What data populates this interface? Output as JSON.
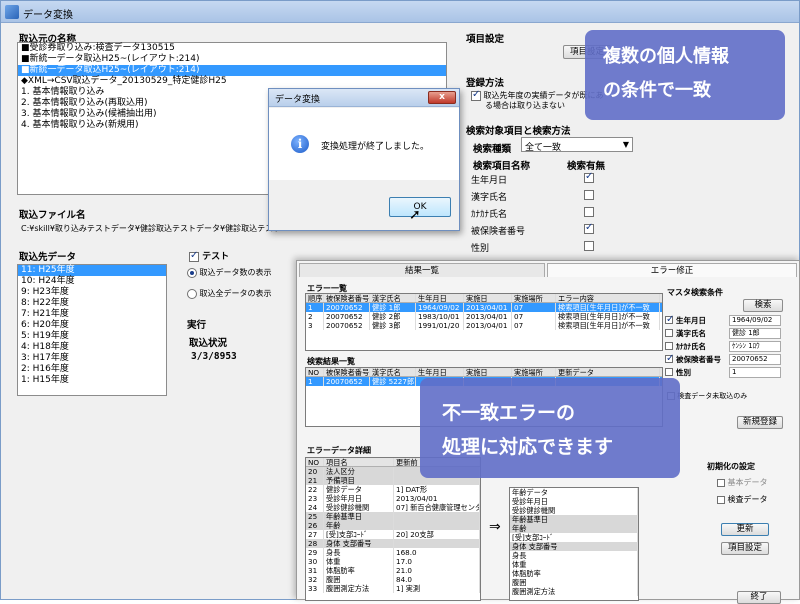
{
  "main_window": {
    "title": "データ変換",
    "source_name_label": "取込元の名称",
    "source_items": [
      {
        "text": "■受診券取り込み:検査データ130515",
        "selected": false
      },
      {
        "text": "■新統一データ取込H25~(レイアウト:214)",
        "selected": false
      },
      {
        "text": "■新統一データ取込H25~(レイアウト:214)",
        "selected": true
      },
      {
        "text": "◆XML→CSV取込データ_20130529_特定健診H25",
        "selected": false
      },
      {
        "text": "1. 基本情報取り込み",
        "selected": false
      },
      {
        "text": "2. 基本情報取り込み(再取込用)",
        "selected": false
      },
      {
        "text": "3. 基本情報取り込み(候補抽出用)",
        "selected": false
      },
      {
        "text": "4. 基本情報取り込み(新規用)",
        "selected": false
      }
    ],
    "file_name_label": "取込ファイル名",
    "file_path": "C:¥skill¥取り込みテストデータ¥健診取込テストデータ¥健診取込テスト",
    "dest_data_label": "取込先データ",
    "dest_items": [
      {
        "text": "11: H25年度",
        "selected": true
      },
      {
        "text": "10: H24年度",
        "selected": false
      },
      {
        "text": "9: H23年度",
        "selected": false
      },
      {
        "text": "8: H22年度",
        "selected": false
      },
      {
        "text": "7: H21年度",
        "selected": false
      },
      {
        "text": "6: H20年度",
        "selected": false
      },
      {
        "text": "5: H19年度",
        "selected": false
      },
      {
        "text": "4: H18年度",
        "selected": false
      },
      {
        "text": "3: H17年度",
        "selected": false
      },
      {
        "text": "2: H16年度",
        "selected": false
      },
      {
        "text": "1: H15年度",
        "selected": false
      }
    ],
    "test_checkbox": "テスト",
    "radio_option1": "取込データ数の表示",
    "radio_option2": "取込全データの表示",
    "execute_label": "実行",
    "status_label": "取込状況",
    "status_value": "3/3/8953",
    "item_settings_label": "項目設定",
    "item_settings_button": "項目設定",
    "register_method_label": "登録方法",
    "register_check_text1": "取込先年度の実績データが既にあ",
    "register_check_text2": "る場合は取り込まない",
    "search_section_label": "検索対象項目と検索方法",
    "search_type_label": "検索種類",
    "search_type_value": "全て一致",
    "search_col_name": "検索項目名称",
    "search_col_flag": "検索有無",
    "search_items": [
      {
        "name": "生年月日",
        "checked": true
      },
      {
        "name": "漢字氏名",
        "checked": false
      },
      {
        "name": "ｶﾅｶﾅ氏名",
        "checked": false
      },
      {
        "name": "被保険者番号",
        "checked": true
      },
      {
        "name": "性別",
        "checked": false
      }
    ]
  },
  "dialog": {
    "title": "データ変換",
    "message": "変換処理が終了しました。",
    "ok_label": "OK",
    "close_symbol": "x"
  },
  "callout_top": {
    "line1": "複数の個人情報",
    "line2": "の条件で一致"
  },
  "callout_bottom": {
    "line1": "不一致エラーの",
    "line2": "処理に対応できます"
  },
  "second_window": {
    "tab1": "結果一覧",
    "tab2": "エラー修正",
    "error_list_label": "エラー一覧",
    "error_headers": [
      "順序",
      "被保険者番号",
      "漢字氏名",
      "生年月日",
      "実施日",
      "実施場所",
      "エラー内容"
    ],
    "error_rows": [
      {
        "cells": [
          "1",
          "20070652",
          "健診 1郎",
          "1964/09/02",
          "2013/04/01",
          "07",
          "検索項目[生年月日]が不一致"
        ],
        "selected": true
      },
      {
        "cells": [
          "2",
          "20070652",
          "健診 2郎",
          "1983/10/01",
          "2013/04/01",
          "07",
          "検索項目[生年月日]が不一致"
        ],
        "selected": false
      },
      {
        "cells": [
          "3",
          "20070652",
          "健診 3郎",
          "1991/01/20",
          "2013/04/01",
          "07",
          "検索項目[生年月日]が不一致"
        ],
        "selected": false
      }
    ],
    "search_result_label": "検索結果一覧",
    "search_headers": [
      "NO",
      "被保険者番号",
      "漢字氏名",
      "生年月日",
      "実施日",
      "実施場所",
      "更新データ"
    ],
    "search_rows": [
      {
        "cells": [
          "1",
          "20070652",
          "健診 5227郎",
          "",
          "",
          "",
          ""
        ],
        "selected": true
      }
    ],
    "match_cond_label": "マスタ検索条件",
    "search_button": "検索",
    "match_items": [
      {
        "label": "生年月日",
        "checked": true,
        "value": "1964/09/02"
      },
      {
        "label": "漢字氏名",
        "checked": false,
        "value": "健診 1郎"
      },
      {
        "label": "ｶﾅｶﾅ氏名",
        "checked": false,
        "value": "ｹﾝｼﾝ 1ﾛｳ"
      },
      {
        "label": "被保険者番号",
        "checked": true,
        "value": "20070652"
      },
      {
        "label": "性別",
        "checked": false,
        "value": "1"
      }
    ],
    "unmatched_check": "検査データ未取込のみ",
    "new_register_button": "新規登録",
    "error_detail_label": "エラーデータ詳細",
    "detail_headers": [
      "NO",
      "項目名",
      "更新前"
    ],
    "detail_rows": [
      {
        "cells": [
          "20",
          "法人区分",
          ""
        ],
        "gray": true
      },
      {
        "cells": [
          "21",
          "予備項目",
          ""
        ],
        "gray": true
      },
      {
        "cells": [
          "22",
          "健診データ",
          "1] DAT形"
        ],
        "gray": false
      },
      {
        "cells": [
          "23",
          "受診年月日",
          "2013/04/01"
        ],
        "gray": false
      },
      {
        "cells": [
          "24",
          "受診健診機関",
          "07] 新百合健康管理センタ"
        ],
        "gray": false
      },
      {
        "cells": [
          "25",
          "年齢基準日",
          ""
        ],
        "gray": true
      },
      {
        "cells": [
          "26",
          "年齢",
          ""
        ],
        "gray": true
      },
      {
        "cells": [
          "27",
          "[受]支部ｺｰﾄﾞ",
          "20] 20支部"
        ],
        "gray": false
      },
      {
        "cells": [
          "28",
          "身体 支部番号",
          ""
        ],
        "gray": true
      },
      {
        "cells": [
          "29",
          "身長",
          "168.0"
        ],
        "gray": false
      },
      {
        "cells": [
          "30",
          "体重",
          "17.0"
        ],
        "gray": false
      },
      {
        "cells": [
          "31",
          "体脂肪率",
          "21.0"
        ],
        "gray": false
      },
      {
        "cells": [
          "32",
          "腹囲",
          "84.0"
        ],
        "gray": false
      },
      {
        "cells": [
          "33",
          "腹囲測定方法",
          "1] 実測"
        ],
        "gray": false
      }
    ],
    "arrow": "⇒",
    "right_rows": [
      {
        "text": "年齢データ",
        "gray": false
      },
      {
        "text": "受診年月日",
        "gray": false
      },
      {
        "text": "受診健診機関",
        "gray": false
      },
      {
        "text": "年齢基準日",
        "gray": true
      },
      {
        "text": "年齢",
        "gray": true
      },
      {
        "text": "[受]支部ｺｰﾄﾞ",
        "gray": false
      },
      {
        "text": "身体 支部番号",
        "gray": true
      },
      {
        "text": "身長",
        "gray": false
      },
      {
        "text": "体重",
        "gray": false
      },
      {
        "text": "体脂肪率",
        "gray": false
      },
      {
        "text": "腹囲",
        "gray": false
      },
      {
        "text": "腹囲測定方法",
        "gray": false
      }
    ],
    "init_label": "初期化の設定",
    "init_check1": "基本データ",
    "init_check2": "検査データ",
    "update_button": "更新",
    "item_settings_button": "項目設定",
    "end_button": "終了"
  }
}
